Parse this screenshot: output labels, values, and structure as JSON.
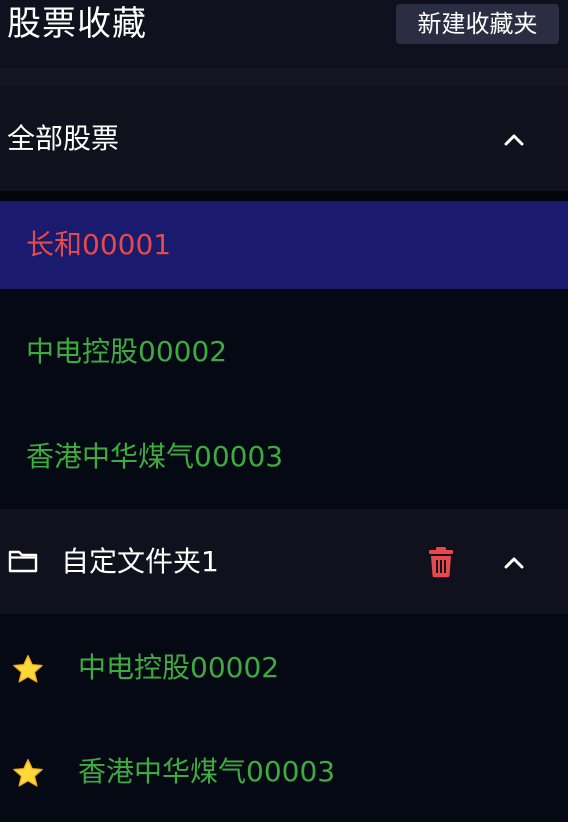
{
  "header": {
    "title": "股票收藏",
    "new_folder_label": "新建收藏夹"
  },
  "all_stocks": {
    "title": "全部股票",
    "expand_icon": "chevron-up-icon",
    "items": [
      {
        "label": "长和00001",
        "selected": true
      },
      {
        "label": "中电控股00002",
        "selected": false
      },
      {
        "label": "香港中华煤气00003",
        "selected": false
      }
    ]
  },
  "custom_folder": {
    "title": "自定文件夹1",
    "folder_icon": "folder-icon",
    "delete_icon": "trash-icon",
    "expand_icon": "chevron-up-icon",
    "items": [
      {
        "label": "中电控股00002",
        "icon": "star-icon"
      },
      {
        "label": "香港中华煤气00003",
        "icon": "star-icon"
      }
    ]
  },
  "colors": {
    "background": "#050913",
    "section_header": "#10111c",
    "selected_row": "#1a1a6f",
    "selected_text": "#e34a4a",
    "stock_text": "#3eaa3f",
    "delete_red": "#e8474b",
    "star_yellow": "#ffd83a"
  }
}
